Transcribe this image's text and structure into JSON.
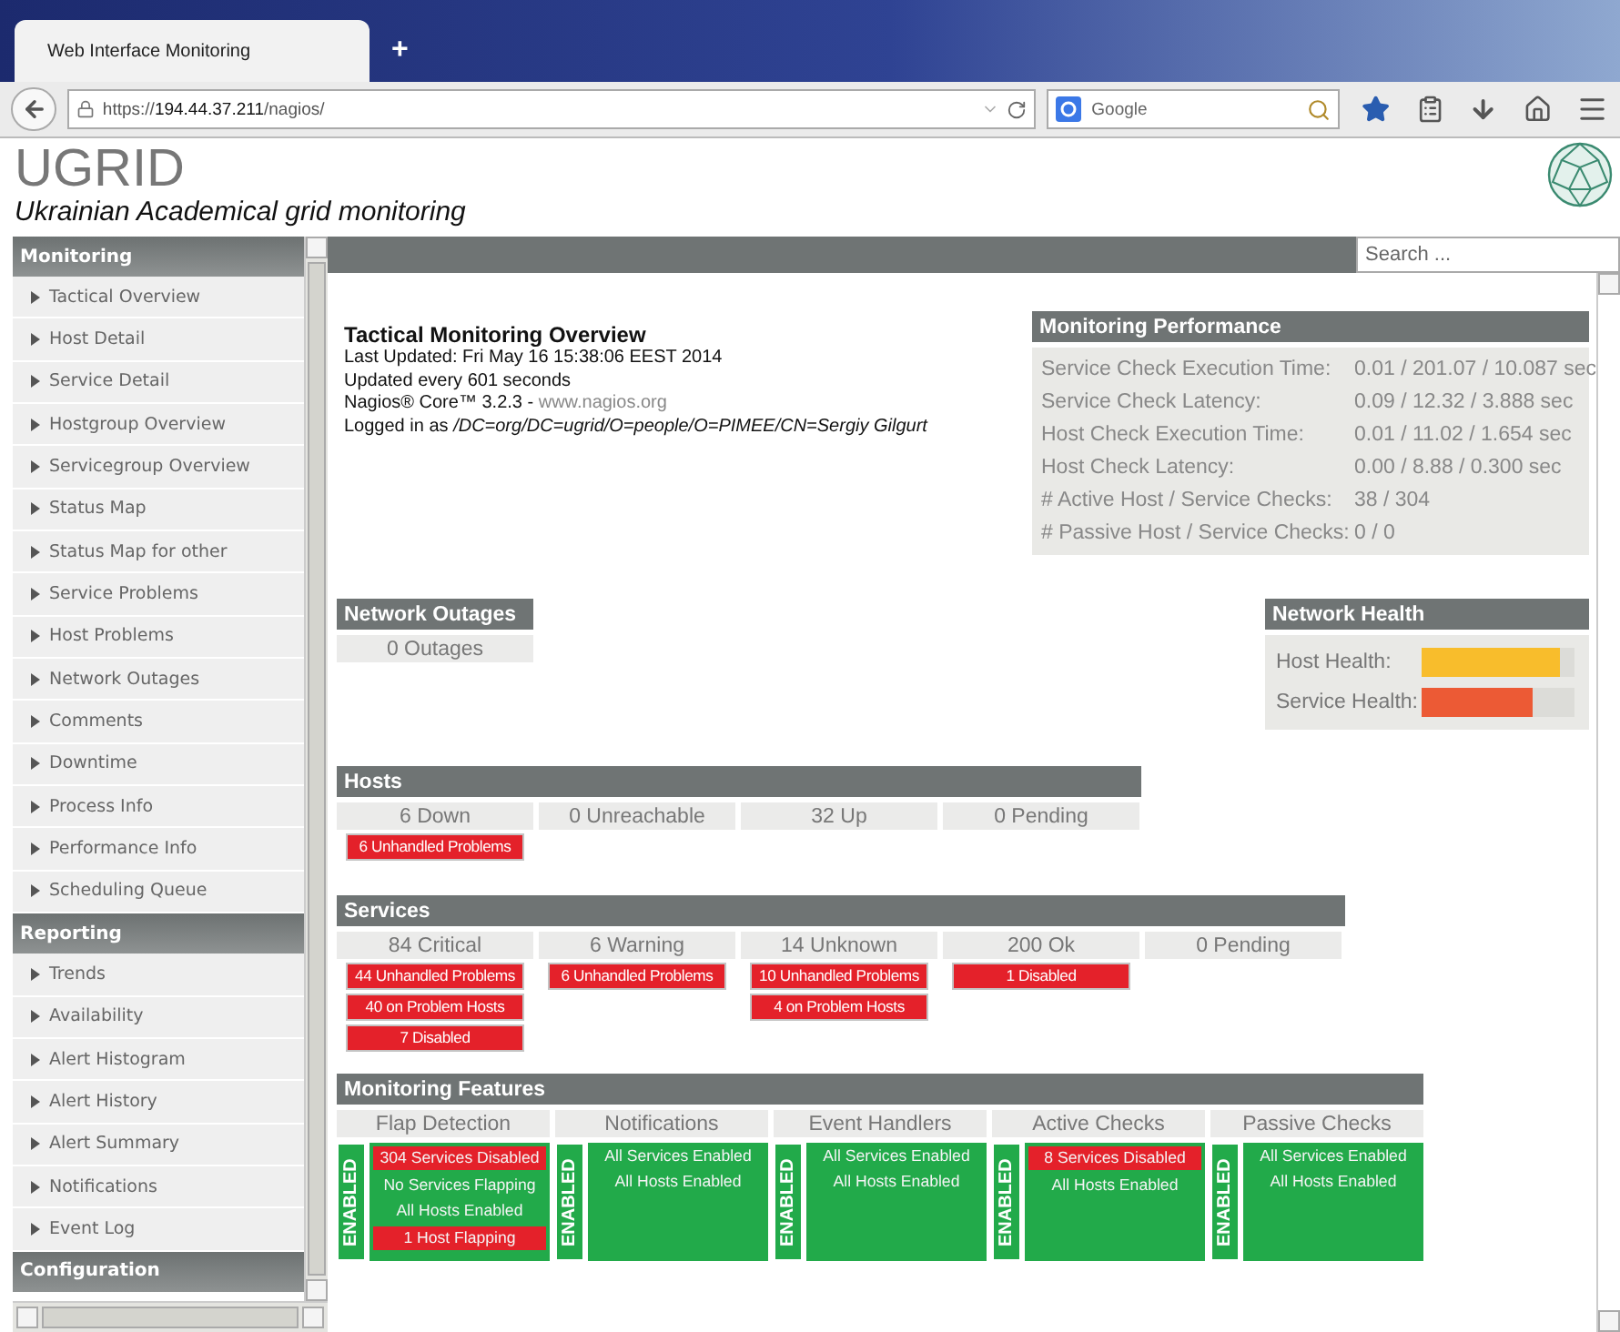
{
  "browser": {
    "tab_title": "Web Interface Monitoring",
    "new_tab": "+",
    "url_scheme": "https://",
    "url_host": "194.44.37.211",
    "url_path": "/nagios/",
    "search_placeholder": "Google"
  },
  "header": {
    "title": "UGRID",
    "subtitle": "Ukrainian Academical grid monitoring"
  },
  "search": {
    "placeholder": "Search ..."
  },
  "sidebar": [
    {
      "title": "Monitoring",
      "items": [
        "Tactical Overview",
        "Host Detail",
        "Service Detail",
        "Hostgroup Overview",
        "Servicegroup Overview",
        "Status Map",
        "Status Map for other",
        "Service Problems",
        "Host Problems",
        "Network Outages",
        "Comments",
        "Downtime",
        "Process Info",
        "Performance Info",
        "Scheduling Queue"
      ]
    },
    {
      "title": "Reporting",
      "items": [
        "Trends",
        "Availability",
        "Alert Histogram",
        "Alert History",
        "Alert Summary",
        "Notifications",
        "Event Log"
      ]
    },
    {
      "title": "Configuration"
    }
  ],
  "overview": {
    "title": "Tactical Monitoring Overview",
    "last_updated": "Last Updated: Fri May 16 15:38:06 EEST 2014",
    "interval": "Updated every 601 seconds",
    "version": "Nagios® Core™ 3.2.3 - ",
    "version_link": "www.nagios.org",
    "logged_in": "Logged in as */DC=org/DC=ugrid/O=people/O=PIMEE/CN=Sergiy Gilgurt*"
  },
  "performance": {
    "title": "Monitoring Performance",
    "rows": [
      {
        "label": "Service Check Execution Time:",
        "value": "0.01 / 201.07 / 10.087 sec"
      },
      {
        "label": "Service Check Latency:",
        "value": "0.09 / 12.32 / 3.888 sec"
      },
      {
        "label": "Host Check Execution Time:",
        "value": "0.01 / 11.02 / 1.654 sec"
      },
      {
        "label": "Host Check Latency:",
        "value": "0.00 / 8.88 / 0.300 sec"
      },
      {
        "label": "# Active Host / Service Checks:",
        "value": "38 / 304"
      },
      {
        "label": "# Passive Host / Service Checks:",
        "value": "0 / 0"
      }
    ]
  },
  "network_outages": {
    "title": "Network Outages",
    "value": "0 Outages"
  },
  "network_health": {
    "title": "Network Health",
    "bars": [
      {
        "label": "Host Health:",
        "level": 0.9,
        "color": "#f8bd2c"
      },
      {
        "label": "Service Health:",
        "level": 0.73,
        "color": "#ec5a35"
      }
    ]
  },
  "hosts": {
    "title": "Hosts",
    "columns": [
      {
        "label": "6 Down",
        "problems": [
          "6 Unhandled Problems"
        ]
      },
      {
        "label": "0 Unreachable"
      },
      {
        "label": "32 Up"
      },
      {
        "label": "0 Pending"
      }
    ]
  },
  "services": {
    "title": "Services",
    "columns": [
      {
        "label": "84 Critical",
        "problems": [
          "44 Unhandled Problems",
          "40 on Problem Hosts",
          "7 Disabled"
        ]
      },
      {
        "label": "6 Warning",
        "problems": [
          "6 Unhandled Problems"
        ]
      },
      {
        "label": "14 Unknown",
        "problems": [
          "10 Unhandled Problems",
          "4 on Problem Hosts"
        ]
      },
      {
        "label": "200 Ok",
        "problems": [
          "1 Disabled"
        ]
      },
      {
        "label": "0 Pending"
      }
    ]
  },
  "features": {
    "title": "Monitoring Features",
    "columns": [
      {
        "label": "Flap Detection",
        "state": "ENABLED",
        "enabled": true,
        "items": [
          {
            "text": "304 Services Disabled",
            "problem": true
          },
          {
            "text": "No Services Flapping",
            "problem": false
          },
          {
            "text": "All Hosts Enabled",
            "problem": false
          },
          {
            "text": "1 Host Flapping",
            "problem": true
          }
        ]
      },
      {
        "label": "Notifications",
        "state": "ENABLED",
        "enabled": true,
        "items": [
          {
            "text": "All Services Enabled",
            "problem": false
          },
          {
            "text": "All Hosts Enabled",
            "problem": false
          }
        ]
      },
      {
        "label": "Event Handlers",
        "state": "ENABLED",
        "enabled": true,
        "items": [
          {
            "text": "All Services Enabled",
            "problem": false
          },
          {
            "text": "All Hosts Enabled",
            "problem": false
          }
        ]
      },
      {
        "label": "Active Checks",
        "state": "ENABLED",
        "enabled": true,
        "items": [
          {
            "text": "8 Services Disabled",
            "problem": true
          },
          {
            "text": "All Hosts Enabled",
            "problem": false
          }
        ]
      },
      {
        "label": "Passive Checks",
        "state": "ENABLED",
        "enabled": true,
        "items": [
          {
            "text": "All Services Enabled",
            "problem": false
          },
          {
            "text": "All Hosts Enabled",
            "problem": false
          }
        ]
      }
    ]
  }
}
